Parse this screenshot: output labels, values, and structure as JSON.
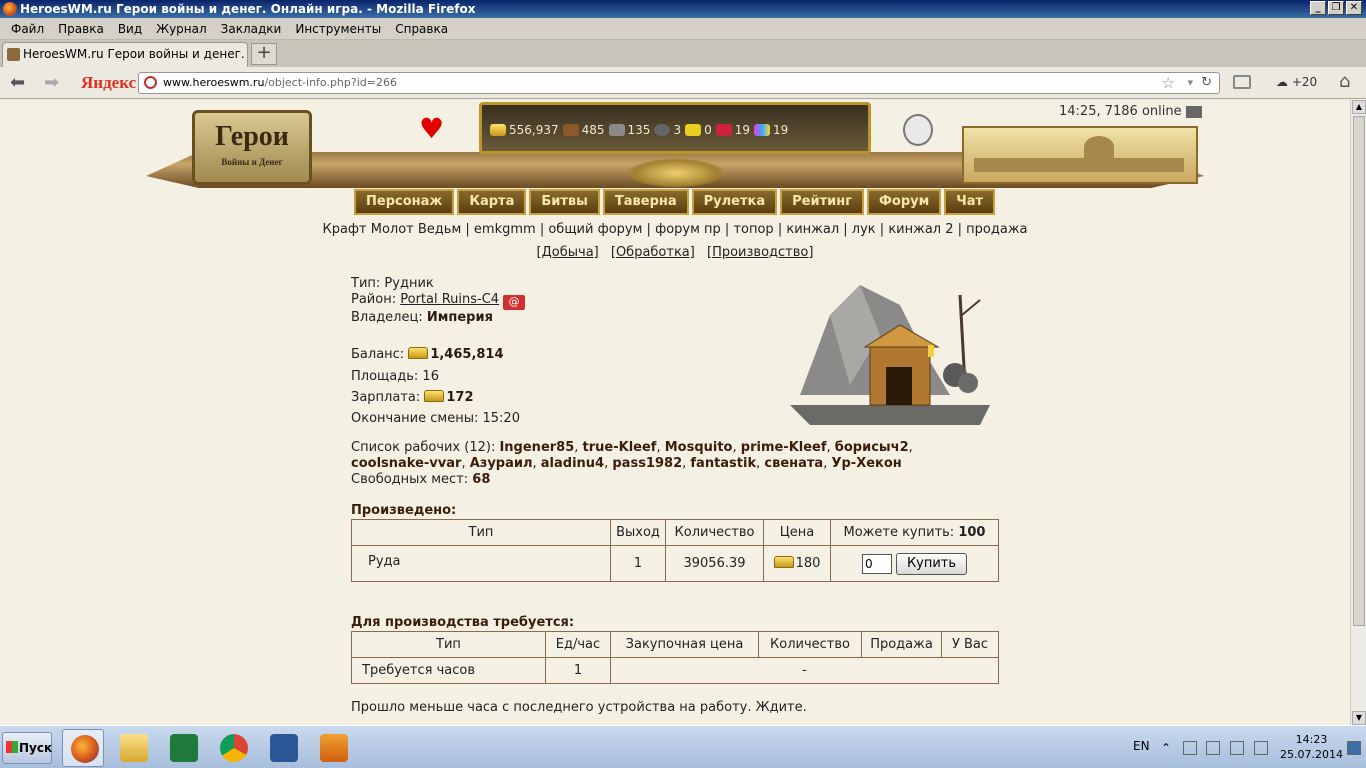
{
  "window": {
    "title": "HeroesWM.ru Герои войны и денег. Онлайн игра. - Mozilla Firefox"
  },
  "menu": [
    "Файл",
    "Правка",
    "Вид",
    "Журнал",
    "Закладки",
    "Инструменты",
    "Справка"
  ],
  "tab": {
    "title": "HeroesWM.ru Герои войны и денег. Онла..."
  },
  "nav": {
    "yandex": "Яндекс",
    "url_domain": "www.heroeswm.ru",
    "url_path": "/object-info.php?id=266",
    "weather": "+20"
  },
  "game": {
    "logo_title": "Герои",
    "logo_subtitle": "Войны и Денег",
    "online": "14:25, 7186 online",
    "resources": {
      "gold": "556,937",
      "wood": "485",
      "ore": "135",
      "mercury": "3",
      "sulfur": "0",
      "crystals": "19",
      "gems": "19"
    },
    "nav_buttons": [
      "Персонаж",
      "Карта",
      "Битвы",
      "Таверна",
      "Рулетка",
      "Рейтинг",
      "Форум",
      "Чат"
    ],
    "links": [
      "Крафт Молот Ведьм",
      "emkgmm",
      "общий форум",
      "форум пр",
      "топор",
      "кинжал",
      "лук",
      "кинжал 2",
      "продажа"
    ],
    "sublinks": [
      "[Добыча]",
      "[Обработка]",
      "[Производство]"
    ]
  },
  "mine": {
    "type_label": "Тип:",
    "type_value": "Рудник",
    "district_label": "Район:",
    "district_value": "Portal Ruins-C4",
    "owner_label": "Владелец:",
    "owner_value": "Империя",
    "balance_label": "Баланс:",
    "balance_value": "1,465,814",
    "area_label": "Площадь:",
    "area_value": "16",
    "salary_label": "Зарплата:",
    "salary_value": "172",
    "shift_label": "Окончание смены:",
    "shift_value": "15:20",
    "workers_label": "Список рабочих (12):",
    "workers": [
      "Ingener85",
      "true-Kleef",
      "Mosquito",
      "prime-Kleef",
      "борисыч2",
      "coolsnake-vvar",
      "Азураил",
      "aladinu4",
      "pass1982",
      "fantastik",
      "свената",
      "Ур-Хекон"
    ],
    "free_label": "Свободных мест:",
    "free_value": "68"
  },
  "produced": {
    "title": "Произведено:",
    "headers": {
      "type": "Тип",
      "output": "Выход",
      "quantity": "Количество",
      "price": "Цена",
      "can_buy": "Можете купить:",
      "can_buy_value": "100"
    },
    "row": {
      "type": "Руда",
      "output": "1",
      "quantity": "39056.39",
      "price": "180",
      "qty_input": "0",
      "buy_button": "Купить"
    }
  },
  "required": {
    "title": "Для производства требуется:",
    "headers": [
      "Тип",
      "Ед/час",
      "Закупочная цена",
      "Количество",
      "Продажа",
      "У Вас"
    ],
    "row": {
      "type": "Требуется часов",
      "per_hour": "1",
      "rest": "-"
    }
  },
  "notice": "Прошло меньше часа с последнего устройства на работу. Ждите.",
  "taskbar": {
    "start": "Пуск",
    "lang": "EN",
    "time": "14:23",
    "date": "25.07.2014"
  }
}
